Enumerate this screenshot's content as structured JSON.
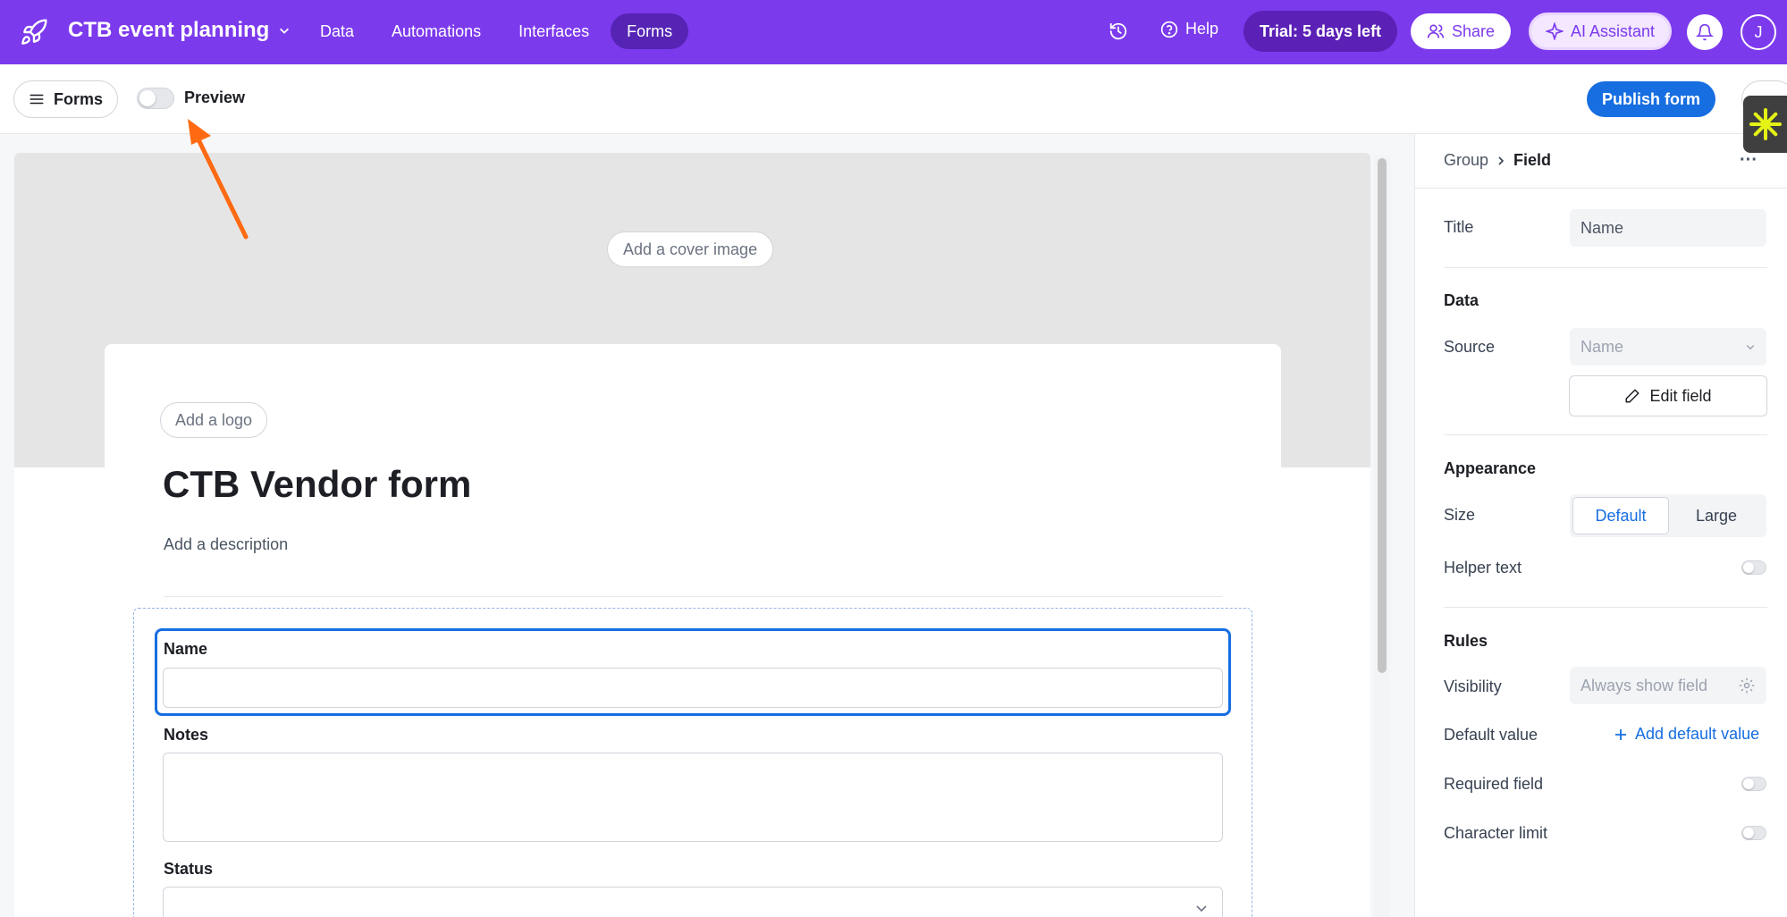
{
  "topbar": {
    "base_name": "CTB event planning",
    "nav": [
      "Data",
      "Automations",
      "Interfaces",
      "Forms"
    ],
    "active_nav": "Forms",
    "help": "Help",
    "trial": "Trial: 5 days left",
    "share": "Share",
    "ai_assistant": "AI Assistant",
    "avatar_initial": "J",
    "accent_color": "#7c3aed"
  },
  "toolbar": {
    "forms_label": "Forms",
    "preview_label": "Preview",
    "preview_on": false,
    "publish_label": "Publish form"
  },
  "form": {
    "cover_button": "Add a cover image",
    "logo_button": "Add a logo",
    "title": "CTB Vendor form",
    "description_placeholder": "Add a description",
    "fields": [
      {
        "label": "Name",
        "type": "text",
        "value": ""
      },
      {
        "label": "Notes",
        "type": "long-text",
        "value": ""
      },
      {
        "label": "Status",
        "type": "select",
        "value": ""
      }
    ]
  },
  "panel": {
    "breadcrumb": {
      "parent": "Group",
      "current": "Field"
    },
    "title_label": "Title",
    "title_value": "Name",
    "data_heading": "Data",
    "source_label": "Source",
    "source_value": "Name",
    "edit_field": "Edit field",
    "appearance_heading": "Appearance",
    "size_label": "Size",
    "size_options": [
      "Default",
      "Large"
    ],
    "size_selected": "Default",
    "helper_text_label": "Helper text",
    "rules_heading": "Rules",
    "visibility_label": "Visibility",
    "visibility_value": "Always show field",
    "default_value_label": "Default value",
    "add_default_value": "Add default value",
    "required_label": "Required field",
    "char_limit_label": "Character limit"
  }
}
